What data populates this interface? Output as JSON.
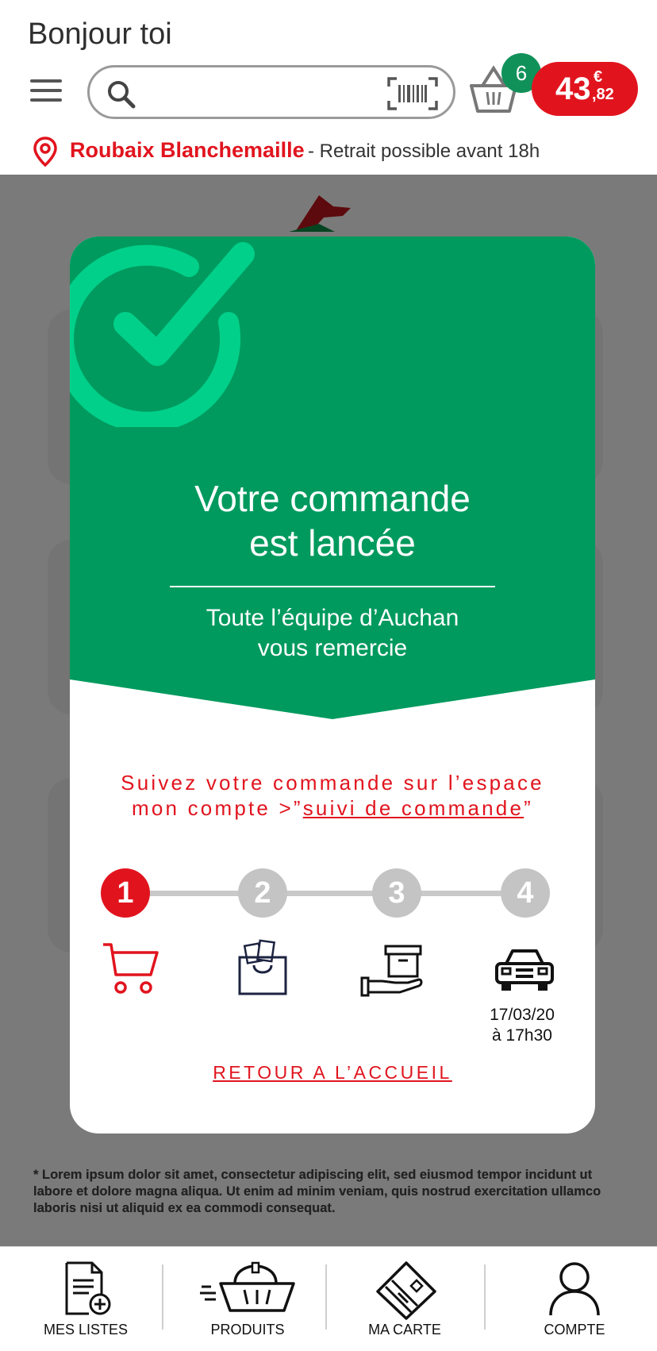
{
  "header": {
    "greeting": "Bonjour toi",
    "search_placeholder": "",
    "basket_count": "6",
    "price_int": "43",
    "price_currency": "€",
    "price_dec": ",82"
  },
  "location": {
    "store": "Roubaix Blanchemaille",
    "info": "- Retrait possible avant 18h"
  },
  "modal": {
    "title_line1": "Votre commande",
    "title_line2": "est lancée",
    "subtitle_line1": "Toute l’équipe d’Auchan",
    "subtitle_line2": "vous remercie",
    "track_prefix": "Suivez votre commande sur l’espace mon compte >”",
    "track_link": "suivi de commande",
    "track_suffix": "”",
    "steps": [
      "1",
      "2",
      "3",
      "4"
    ],
    "pickup_date": "17/03/20",
    "pickup_time": "à 17h30",
    "back_label": "RETOUR A L’ACCUEIL"
  },
  "footnote": "* Lorem ipsum dolor sit amet, consectetur adipiscing elit, sed eiusmod tempor incidunt ut labore et dolore magna aliqua. Ut enim ad minim veniam, quis nostrud exercitation ullamco laboris nisi ut aliquid ex ea commodi consequat.",
  "nav": {
    "lists": "MES LISTES",
    "products": "PRODUITS",
    "card": "MA CARTE",
    "account": "COMPTE"
  },
  "colors": {
    "brand_red": "#e1141e",
    "brand_green": "#009a5e",
    "check_green": "#00d08a"
  },
  "icons": {
    "menu": "hamburger-menu-icon",
    "search": "search-icon",
    "barcode": "barcode-scan-icon",
    "basket": "basket-icon",
    "location": "location-pin-icon",
    "check": "check-circle-icon",
    "cart": "cart-icon",
    "bag": "shopping-bag-icon",
    "box": "box-handover-icon",
    "car": "car-icon"
  }
}
